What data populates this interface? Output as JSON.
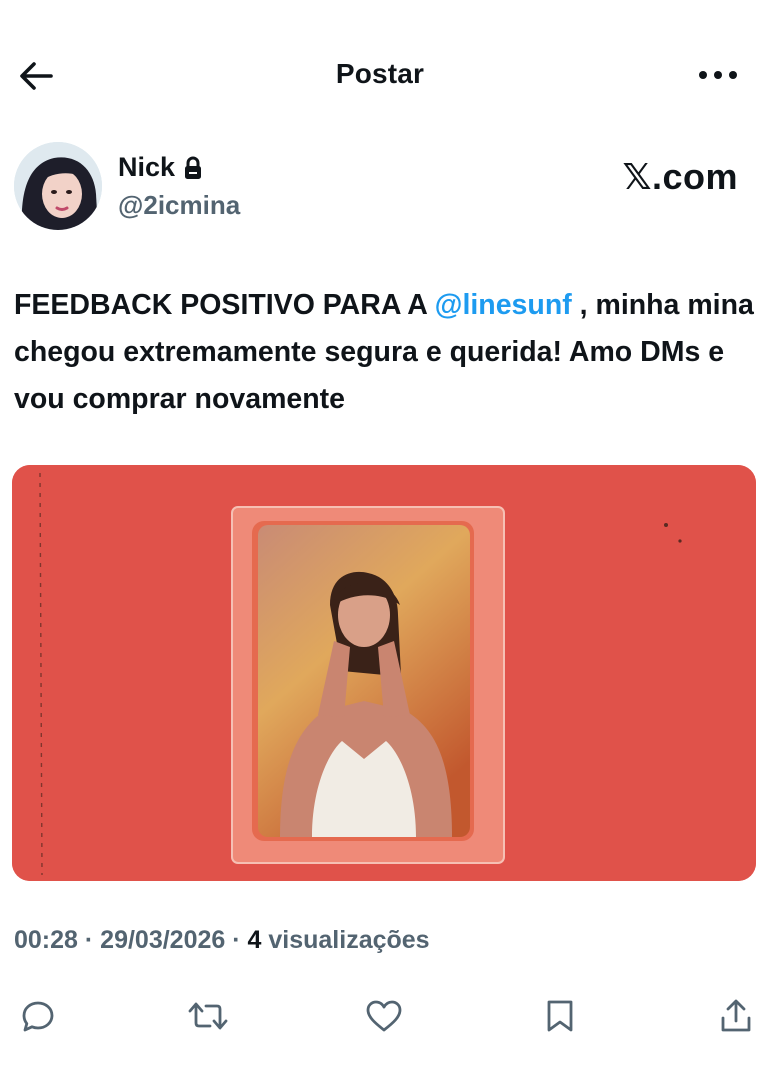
{
  "header": {
    "title": "Postar",
    "back_icon": "arrow-left-icon",
    "more_icon": "more-horizontal-icon"
  },
  "author": {
    "display_name": "Nick",
    "handle": "@2icmina",
    "protected_icon": "lock-icon",
    "avatar": "avatar"
  },
  "brand": "𝕏.com",
  "tweet": {
    "text_before": "FEEDBACK POSITIVO PARA A ",
    "mention": "@linesunf",
    "text_after": " , minha mina chegou extremamente segura e querida! Amo DMs e vou comprar novamente"
  },
  "meta": {
    "time": "00:28",
    "sep1": " · ",
    "date": "29/03/2026",
    "sep2": " · ",
    "views_count": "4",
    "views_label": " visualizações"
  },
  "actions": [
    {
      "icon": "reply-icon"
    },
    {
      "icon": "retweet-icon"
    },
    {
      "icon": "like-icon"
    },
    {
      "icon": "bookmark-icon"
    },
    {
      "icon": "share-icon"
    }
  ],
  "colors": {
    "accent": "#1d9bf0",
    "secondary_text": "#536471",
    "photo_background": "#e0524a"
  }
}
